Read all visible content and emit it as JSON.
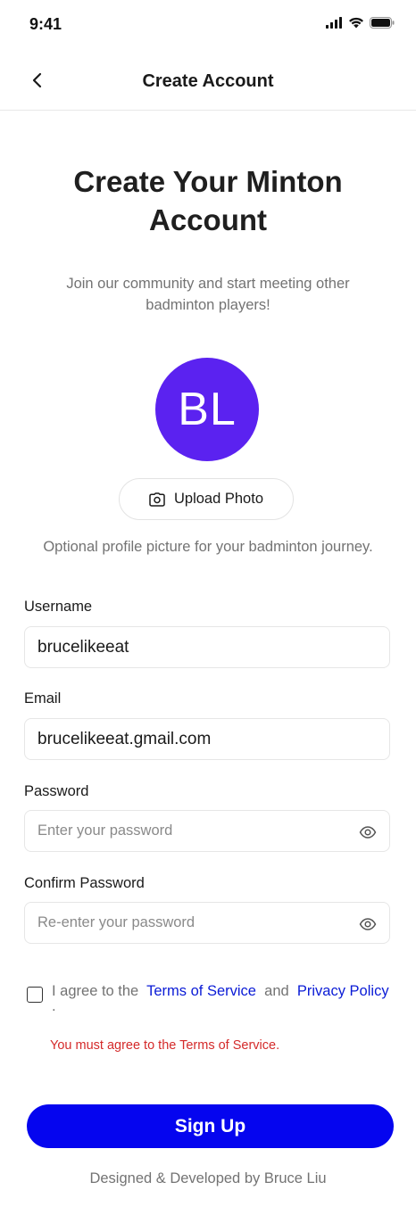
{
  "status_bar": {
    "time": "9:41",
    "icons": [
      "signal-icon",
      "wifi-icon",
      "battery-icon"
    ]
  },
  "nav": {
    "back_icon": "chevron-left-icon",
    "title": "Create Account"
  },
  "hero": {
    "heading": "Create Your Minton Account",
    "subheading": "Join our community and start meeting other badminton players!"
  },
  "avatar": {
    "initials": "BL",
    "color": "#5b22f0"
  },
  "upload": {
    "icon": "camera-icon",
    "label": "Upload Photo",
    "hint": "Optional profile picture for your badminton journey."
  },
  "form": {
    "username": {
      "label": "Username",
      "value": "brucelikeeat"
    },
    "email": {
      "label": "Email",
      "value": "brucelikeeat.gmail.com"
    },
    "password": {
      "label": "Password",
      "placeholder": "Enter your password",
      "icon": "eye-icon"
    },
    "confirm_password": {
      "label": "Confirm Password",
      "placeholder": "Re-enter your password",
      "icon": "eye-icon"
    }
  },
  "terms": {
    "checked": false,
    "prefix": "I agree to the",
    "terms_link": "Terms of Service",
    "connector": "and",
    "privacy_link": "Privacy Policy",
    "suffix": ".",
    "error": "You must agree to the Terms of Service."
  },
  "submit": {
    "label": "Sign Up",
    "color": "#0505ef"
  },
  "footer": {
    "credit": "Designed & Developed by Bruce Liu"
  }
}
